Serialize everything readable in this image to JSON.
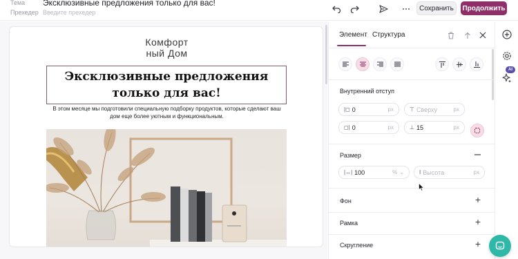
{
  "header": {
    "subject_label": "Тема",
    "subject_value": "Эксклюзивные предложения только для вас!",
    "preheader_label": "Прехедер",
    "preheader_placeholder": "Введите прехедер",
    "save_label": "Сохранить",
    "continue_label": "Продолжить",
    "icons": [
      "undo-icon",
      "redo-icon",
      "send-icon",
      "more-icon"
    ]
  },
  "email": {
    "logo_line1": "Комфорт",
    "logo_line2": "ный Дом",
    "headline": "Эксклюзивные предложения только для вас!",
    "body": "В этом месяце мы подготовили специальную подборку продуктов, которые сделают ваш дом еще более уютным и функциональным."
  },
  "panel": {
    "tabs": [
      {
        "label": "Элемент",
        "active": true
      },
      {
        "label": "Структура",
        "active": false
      }
    ],
    "alignment": {
      "options": [
        "align-left",
        "align-center",
        "align-right",
        "align-justify"
      ],
      "selected": "align-center",
      "vertical_options": [
        "valign-top",
        "valign-middle",
        "valign-bottom"
      ]
    },
    "padding": {
      "title": "Внутренний отступ",
      "left": {
        "value": "0",
        "unit": "px"
      },
      "top": {
        "placeholder": "Сверху",
        "unit": "px"
      },
      "right": {
        "value": "0",
        "unit": "px"
      },
      "bottom": {
        "value": "15",
        "unit": "px"
      }
    },
    "size": {
      "title": "Размер",
      "width": {
        "value": "100",
        "unit": "%"
      },
      "height": {
        "placeholder": "Высота",
        "unit": "px"
      }
    },
    "sections": [
      {
        "title": "Фон"
      },
      {
        "title": "Рамка"
      },
      {
        "title": "Скругление"
      }
    ]
  },
  "rail": {
    "ai_badge": "AI",
    "icons": [
      "add-icon",
      "settings-icon",
      "ai-sparkle-icon"
    ]
  },
  "colors": {
    "accent": "#8e2f6a",
    "accent_light": "#f7dde6",
    "chat": "#2fb8a8"
  }
}
